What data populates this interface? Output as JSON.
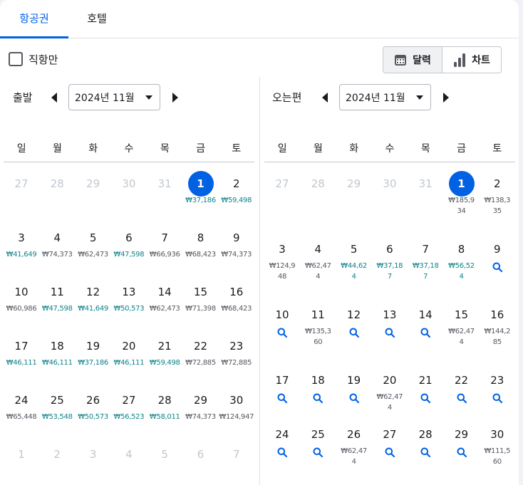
{
  "tabs": [
    "항공권",
    "호텔"
  ],
  "direct_only": "직항만",
  "view_toggle": {
    "calendar": "달력",
    "chart": "차트"
  },
  "colors": {
    "accent": "#0062e3",
    "low_price": "#0c838a",
    "price": "#545860",
    "muted": "#c1c7cf"
  },
  "weekdays": [
    "일",
    "월",
    "화",
    "수",
    "목",
    "금",
    "토"
  ],
  "outbound": {
    "title": "출발",
    "month": "2024년 11월",
    "days": [
      {
        "d": "27",
        "m": 1
      },
      {
        "d": "28",
        "m": 1
      },
      {
        "d": "29",
        "m": 1
      },
      {
        "d": "30",
        "m": 1
      },
      {
        "d": "31",
        "m": 1
      },
      {
        "d": "1",
        "p": "₩37,186",
        "low": 1,
        "sel": 1
      },
      {
        "d": "2",
        "p": "₩59,498",
        "low": 1
      },
      {
        "d": "3",
        "p": "₩41,649",
        "low": 1
      },
      {
        "d": "4",
        "p": "₩74,373"
      },
      {
        "d": "5",
        "p": "₩62,473"
      },
      {
        "d": "6",
        "p": "₩47,598",
        "low": 1
      },
      {
        "d": "7",
        "p": "₩66,936"
      },
      {
        "d": "8",
        "p": "₩68,423"
      },
      {
        "d": "9",
        "p": "₩74,373"
      },
      {
        "d": "10",
        "p": "₩60,986"
      },
      {
        "d": "11",
        "p": "₩47,598",
        "low": 1
      },
      {
        "d": "12",
        "p": "₩41,649",
        "low": 1
      },
      {
        "d": "13",
        "p": "₩50,573",
        "low": 1
      },
      {
        "d": "14",
        "p": "₩62,473"
      },
      {
        "d": "15",
        "p": "₩71,398"
      },
      {
        "d": "16",
        "p": "₩68,423"
      },
      {
        "d": "17",
        "p": "₩46,111",
        "low": 1
      },
      {
        "d": "18",
        "p": "₩46,111",
        "low": 1
      },
      {
        "d": "19",
        "p": "₩37,186",
        "low": 1
      },
      {
        "d": "20",
        "p": "₩46,111",
        "low": 1
      },
      {
        "d": "21",
        "p": "₩59,498",
        "low": 1
      },
      {
        "d": "22",
        "p": "₩72,885"
      },
      {
        "d": "23",
        "p": "₩72,885"
      },
      {
        "d": "24",
        "p": "₩65,448"
      },
      {
        "d": "25",
        "p": "₩53,548",
        "low": 1
      },
      {
        "d": "26",
        "p": "₩50,573",
        "low": 1
      },
      {
        "d": "27",
        "p": "₩56,523",
        "low": 1
      },
      {
        "d": "28",
        "p": "₩58,011",
        "low": 1
      },
      {
        "d": "29",
        "p": "₩74,373"
      },
      {
        "d": "30",
        "p": "₩124,947"
      },
      {
        "d": "1",
        "m": 1
      },
      {
        "d": "2",
        "m": 1
      },
      {
        "d": "3",
        "m": 1
      },
      {
        "d": "4",
        "m": 1
      },
      {
        "d": "5",
        "m": 1
      },
      {
        "d": "6",
        "m": 1
      },
      {
        "d": "7",
        "m": 1
      }
    ]
  },
  "return": {
    "title": "오는편",
    "month": "2024년 11월",
    "days": [
      {
        "d": "27",
        "m": 1
      },
      {
        "d": "28",
        "m": 1
      },
      {
        "d": "29",
        "m": 1
      },
      {
        "d": "30",
        "m": 1
      },
      {
        "d": "31",
        "m": 1
      },
      {
        "d": "1",
        "p": "₩185,934",
        "sel": 1
      },
      {
        "d": "2",
        "p": "₩138,335"
      },
      {
        "d": "3",
        "p": "₩124,948"
      },
      {
        "d": "4",
        "p": "₩62,474"
      },
      {
        "d": "5",
        "p": "₩44,624",
        "low": 1
      },
      {
        "d": "6",
        "p": "₩37,187",
        "low": 1
      },
      {
        "d": "7",
        "p": "₩37,187",
        "low": 1
      },
      {
        "d": "8",
        "p": "₩56,524",
        "low": 1
      },
      {
        "d": "9",
        "s": 1
      },
      {
        "d": "10",
        "s": 1
      },
      {
        "d": "11",
        "p": "₩135,360"
      },
      {
        "d": "12",
        "s": 1
      },
      {
        "d": "13",
        "s": 1
      },
      {
        "d": "14",
        "s": 1
      },
      {
        "d": "15",
        "p": "₩62,474"
      },
      {
        "d": "16",
        "p": "₩144,285"
      },
      {
        "d": "17",
        "s": 1
      },
      {
        "d": "18",
        "s": 1
      },
      {
        "d": "19",
        "s": 1
      },
      {
        "d": "20",
        "p": "₩62,474"
      },
      {
        "d": "21",
        "s": 1
      },
      {
        "d": "22",
        "s": 1
      },
      {
        "d": "23",
        "s": 1
      },
      {
        "d": "24",
        "s": 1
      },
      {
        "d": "25",
        "s": 1
      },
      {
        "d": "26",
        "p": "₩62,474"
      },
      {
        "d": "27",
        "s": 1
      },
      {
        "d": "28",
        "s": 1
      },
      {
        "d": "29",
        "s": 1
      },
      {
        "d": "30",
        "p": "₩111,560"
      }
    ]
  }
}
